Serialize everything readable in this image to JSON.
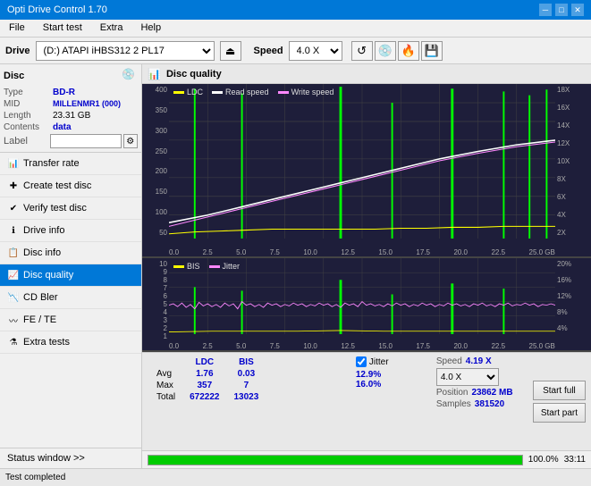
{
  "titlebar": {
    "title": "Opti Drive Control 1.70",
    "min_btn": "─",
    "max_btn": "□",
    "close_btn": "✕"
  },
  "menubar": {
    "items": [
      "File",
      "Start test",
      "Extra",
      "Help"
    ]
  },
  "drivebar": {
    "label": "Drive",
    "drive_value": "(D:) ATAPI iHBS312 2 PL17",
    "speed_label": "Speed",
    "speed_value": "4.0 X"
  },
  "disc": {
    "title": "Disc",
    "type_label": "Type",
    "type_val": "BD-R",
    "mid_label": "MID",
    "mid_val": "MILLENMR1 (000)",
    "length_label": "Length",
    "length_val": "23.31 GB",
    "contents_label": "Contents",
    "contents_val": "data",
    "label_label": "Label"
  },
  "nav": {
    "items": [
      {
        "id": "transfer-rate",
        "label": "Transfer rate",
        "active": false
      },
      {
        "id": "create-test-disc",
        "label": "Create test disc",
        "active": false
      },
      {
        "id": "verify-test-disc",
        "label": "Verify test disc",
        "active": false
      },
      {
        "id": "drive-info",
        "label": "Drive info",
        "active": false
      },
      {
        "id": "disc-info",
        "label": "Disc info",
        "active": false
      },
      {
        "id": "disc-quality",
        "label": "Disc quality",
        "active": true
      },
      {
        "id": "cd-bler",
        "label": "CD Bler",
        "active": false
      },
      {
        "id": "fe-te",
        "label": "FE / TE",
        "active": false
      },
      {
        "id": "extra-tests",
        "label": "Extra tests",
        "active": false
      }
    ]
  },
  "status_window": {
    "label": "Status window >>"
  },
  "chart": {
    "title": "Disc quality",
    "legend_top": [
      {
        "label": "LDC",
        "color": "#ffff00"
      },
      {
        "label": "Read speed",
        "color": "#ffffff"
      },
      {
        "label": "Write speed",
        "color": "#ff88ff"
      }
    ],
    "legend_bottom": [
      {
        "label": "BIS",
        "color": "#ffff00"
      },
      {
        "label": "Jitter",
        "color": "#ff88ff"
      }
    ],
    "y_labels_top_left": [
      "400",
      "350",
      "300",
      "250",
      "200",
      "150",
      "100",
      "50"
    ],
    "y_labels_top_right": [
      "18X",
      "16X",
      "14X",
      "12X",
      "10X",
      "8X",
      "6X",
      "4X",
      "2X"
    ],
    "y_labels_bottom_left": [
      "10",
      "9",
      "8",
      "7",
      "6",
      "5",
      "4",
      "3",
      "2",
      "1"
    ],
    "y_labels_bottom_right": [
      "20%",
      "16%",
      "12%",
      "8%",
      "4%"
    ],
    "x_labels": [
      "0.0",
      "2.5",
      "5.0",
      "7.5",
      "10.0",
      "12.5",
      "15.0",
      "17.5",
      "20.0",
      "22.5",
      "25.0 GB"
    ]
  },
  "stats": {
    "col_headers": [
      "LDC",
      "BIS"
    ],
    "avg_label": "Avg",
    "avg_ldc": "1.76",
    "avg_bis": "0.03",
    "max_label": "Max",
    "max_ldc": "357",
    "max_bis": "7",
    "total_label": "Total",
    "total_ldc": "672222",
    "total_bis": "13023",
    "jitter_checked": true,
    "jitter_label": "Jitter",
    "jitter_avg": "12.9%",
    "jitter_max": "16.0%",
    "speed_label": "Speed",
    "speed_val": "4.19 X",
    "speed_select": "4.0 X",
    "position_label": "Position",
    "position_val": "23862 MB",
    "samples_label": "Samples",
    "samples_val": "381520",
    "btn_start_full": "Start full",
    "btn_start_part": "Start part"
  },
  "progress": {
    "percent": 100,
    "percent_text": "100.0%",
    "time": "33:11"
  },
  "status": {
    "text": "Test completed"
  }
}
